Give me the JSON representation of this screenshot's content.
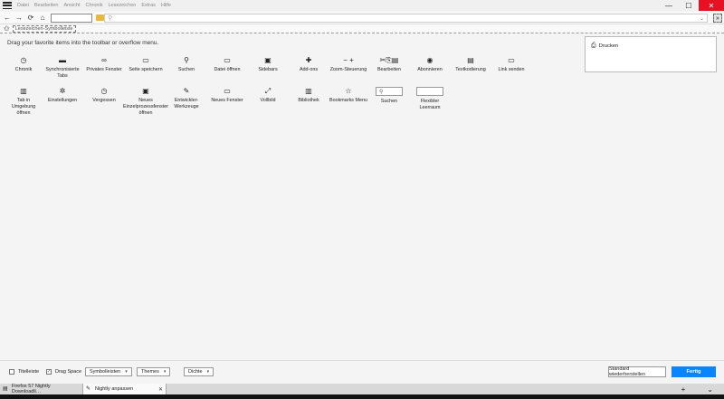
{
  "menubar": {
    "items": [
      "Datei",
      "Bearbeiten",
      "Ansicht",
      "Chronik",
      "Lesezeichen",
      "Extras",
      "Hilfe"
    ],
    "min": "—",
    "max": "☐",
    "close": "✕"
  },
  "navbar": {
    "back": "←",
    "forward": "→",
    "reload": "⟳",
    "home": "⌂",
    "url_pin": "⚲",
    "url_dropdown": "⌄",
    "overflow": "»"
  },
  "bookmarks": {
    "label": "Lesezeichen-Symbolleiste"
  },
  "main": {
    "instruction": "Drag your favorite items into the toolbar or overflow menu."
  },
  "palette_row1": [
    {
      "label": "Chronik",
      "icon": "◷"
    },
    {
      "label": "Synchronisierte Tabs",
      "icon": "▬"
    },
    {
      "label": "Privates Fenster",
      "icon": "∞"
    },
    {
      "label": "Seite speichern",
      "icon": "▭"
    },
    {
      "label": "Suchen",
      "icon": "⚲"
    },
    {
      "label": "Datei öffnen",
      "icon": "▭"
    },
    {
      "label": "Sidebars",
      "icon": "▣"
    },
    {
      "label": "Add-ons",
      "icon": "✚"
    },
    {
      "label": "Zoom-Steuerung",
      "icon": "− +"
    },
    {
      "label": "Bearbeiten",
      "icon": "✂⎘▤"
    },
    {
      "label": "Abonnieren",
      "icon": "◉"
    },
    {
      "label": "Textkodierung",
      "icon": "▤"
    },
    {
      "label": "Link senden",
      "icon": "▭"
    }
  ],
  "palette_row2": [
    {
      "label": "Tab in Umgebung öffnen",
      "icon": "▥"
    },
    {
      "label": "Einstellungen",
      "icon": "✲"
    },
    {
      "label": "Vergessen",
      "icon": "◷"
    },
    {
      "label": "Neues Einzelprozessfenster öffnen",
      "icon": "▣"
    },
    {
      "label": "Entwickler-Werkzeuge",
      "icon": "✎"
    },
    {
      "label": "Neues Fenster",
      "icon": "▭"
    },
    {
      "label": "Vollbild",
      "icon": "⤢"
    },
    {
      "label": "Bibliothek",
      "icon": "▥"
    },
    {
      "label": "Bookmarks Menu",
      "icon": "☆"
    },
    {
      "label": "Suchen",
      "icon": "⚲",
      "box": true
    },
    {
      "label": "Flexibler Leerraum",
      "icon": "",
      "box": true
    }
  ],
  "overflow_panel": {
    "item": "Drucken",
    "icon": "⎙"
  },
  "bottom": {
    "titlebar": "Titelleiste",
    "dragspace": "Drag Space",
    "toolbars": "Symbolleisten",
    "themes": "Themes",
    "density": "Dichte",
    "reset": "Standard wiederherstellen",
    "done": "Fertig",
    "check": "✓",
    "caret": "▾"
  },
  "tabs": [
    {
      "label": "Firefox 57 Nightly Downloadli…",
      "icon": "▤",
      "active": false
    },
    {
      "label": "Nightly anpassen",
      "icon": "✎",
      "active": true
    }
  ],
  "tabstrip": {
    "new_tab": "+",
    "list": "⌄"
  }
}
